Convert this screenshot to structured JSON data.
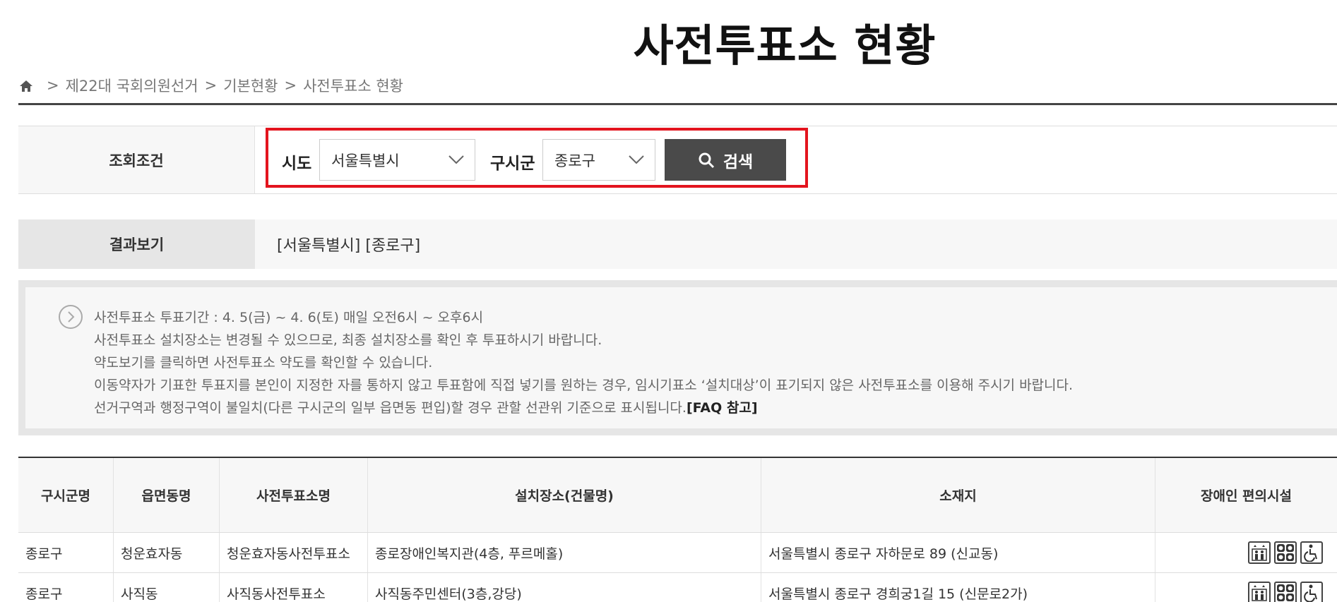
{
  "page": {
    "title": "사전투표소 현황"
  },
  "breadcrumb": {
    "sep": ">",
    "items": [
      "제22대 국회의원선거",
      "기본현황",
      "사전투표소 현황"
    ]
  },
  "search": {
    "section_label": "조회조건",
    "sido_label": "시도",
    "sido_value": "서울특별시",
    "gu_label": "구시군",
    "gu_value": "종로구",
    "button_label": "검색",
    "highlight_color": "#e3141e"
  },
  "result": {
    "label": "결과보기",
    "value": "[서울특별시] [종로구]"
  },
  "notice": {
    "lines": [
      "사전투표소 투표기간 : 4. 5(금) ~ 4. 6(토) 매일 오전6시 ~ 오후6시",
      "사전투표소 설치장소는 변경될 수 있으므로, 최종 설치장소를 확인 후 투표하시기 바랍니다.",
      "약도보기를 클릭하면 사전투표소 약도를 확인할 수 있습니다.",
      "이동약자가 기표한 투표지를 본인이 지정한 자를 통하지 않고 투표함에 직접 넣기를 원하는 경우, 임시기표소 ‘설치대상’이 표기되지 않은 사전투표소를 이용해 주시기 바랍니다.",
      "선거구역과 행정구역이 불일치(다른 구시군의 일부 읍면동 편입)할 경우 관할 선관위 기준으로 표시됩니다."
    ],
    "faq_link": "[FAQ 참고]"
  },
  "table": {
    "headers": [
      "구시군명",
      "읍면동명",
      "사전투표소명",
      "설치장소(건물명)",
      "소재지",
      "장애인 편의시설"
    ],
    "rows": [
      [
        "종로구",
        "청운효자동",
        "청운효자동사전투표소",
        "종로장애인복지관(4층, 푸르메홀)",
        "서울특별시 종로구 자하문로 89 (신교동)"
      ],
      [
        "종로구",
        "사직동",
        "사직동사전투표소",
        "사직동주민센터(3층,강당)",
        "서울특별시 종로구 경희궁1길 15 (신문로2가)"
      ]
    ],
    "facility_icons": [
      "elevator-icon",
      "accessible-toilet-icon",
      "wheelchair-icon"
    ]
  }
}
